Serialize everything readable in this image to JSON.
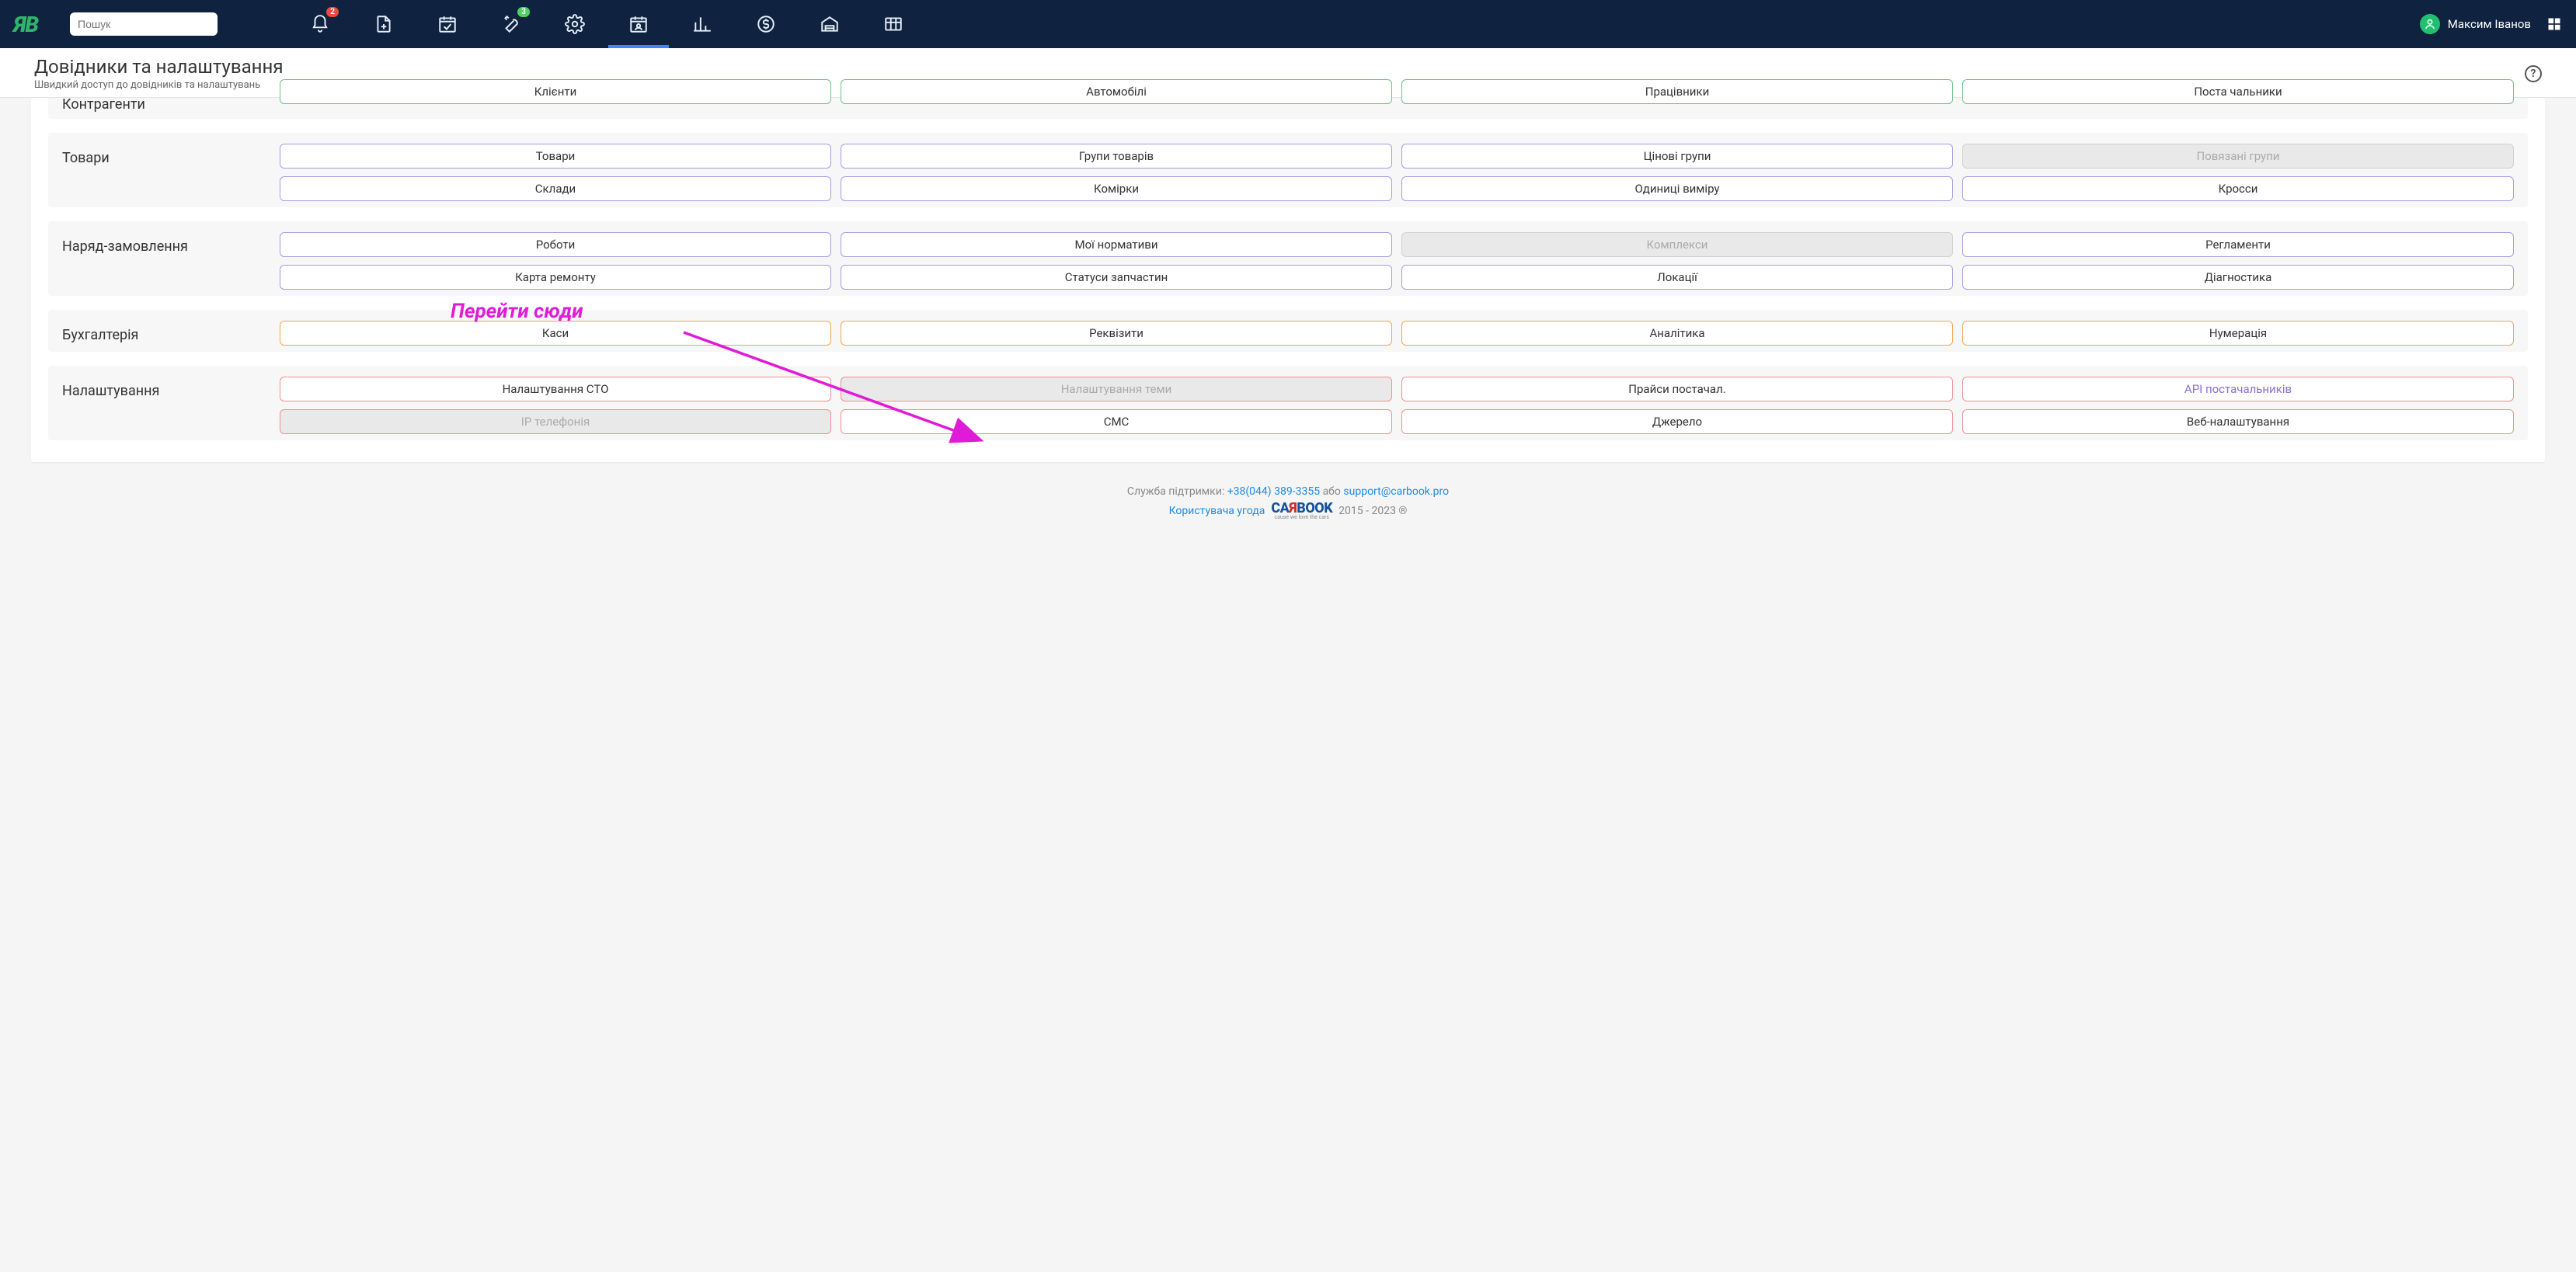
{
  "search": {
    "placeholder": "Пошук"
  },
  "badges": {
    "notifications": "2",
    "tools": "3"
  },
  "user": {
    "name": "Максим Іванов"
  },
  "page": {
    "title": "Довідники та налаштування",
    "subtitle": "Швидкий доступ до довідників та налаштувань"
  },
  "cutoff": {
    "label": "Контрагенти",
    "items": [
      "Клієнти",
      "Автомобілі",
      "Працівники",
      "Поста чальники"
    ]
  },
  "sections": [
    {
      "id": "goods",
      "label": "Товари",
      "colorClass": "c-purple",
      "items": [
        {
          "t": "Товари"
        },
        {
          "t": "Групи товарів"
        },
        {
          "t": "Цінові групи"
        },
        {
          "t": "Повязані групи",
          "disabled": true
        },
        {
          "t": "Склади"
        },
        {
          "t": "Комірки"
        },
        {
          "t": "Одиниці виміру"
        },
        {
          "t": "Кросси"
        }
      ]
    },
    {
      "id": "order",
      "label": "Наряд-замовлення",
      "colorClass": "c-purple",
      "items": [
        {
          "t": "Роботи"
        },
        {
          "t": "Мої нормативи"
        },
        {
          "t": "Комплекси",
          "disabled": true
        },
        {
          "t": "Регламенти"
        },
        {
          "t": "Карта ремонту"
        },
        {
          "t": "Статуси запчастин"
        },
        {
          "t": "Локації"
        },
        {
          "t": "Діагностика"
        }
      ]
    },
    {
      "id": "accounting",
      "label": "Бухгалтерія",
      "colorClass": "c-orange",
      "items": [
        {
          "t": "Каси"
        },
        {
          "t": "Реквізити"
        },
        {
          "t": "Аналітика"
        },
        {
          "t": "Нумерація"
        }
      ]
    },
    {
      "id": "settings",
      "label": "Налаштування",
      "colorClass": "c-red",
      "items": [
        {
          "t": "Налаштування СТО"
        },
        {
          "t": "Налаштування теми",
          "disabled": true
        },
        {
          "t": "Прайси постачал."
        },
        {
          "t": "API постачальників",
          "highlight": true
        },
        {
          "t": "IP телефонія",
          "disabled": true
        },
        {
          "t": "СМС"
        },
        {
          "t": "Джерело"
        },
        {
          "t": "Веб-налаштування"
        }
      ]
    }
  ],
  "annotation": {
    "text": "Перейти сюди"
  },
  "footer": {
    "support_label": "Служба підтримки:",
    "phone": "+38(044) 389-3355",
    "or": "або",
    "email": "support@carbook.pro",
    "agreement": "Користувача угода",
    "logo_a": "CA",
    "logo_b": "Я",
    "logo_c": "BOOK",
    "tagline": "cause we love the cars",
    "years": "2015 - 2023 ®"
  }
}
